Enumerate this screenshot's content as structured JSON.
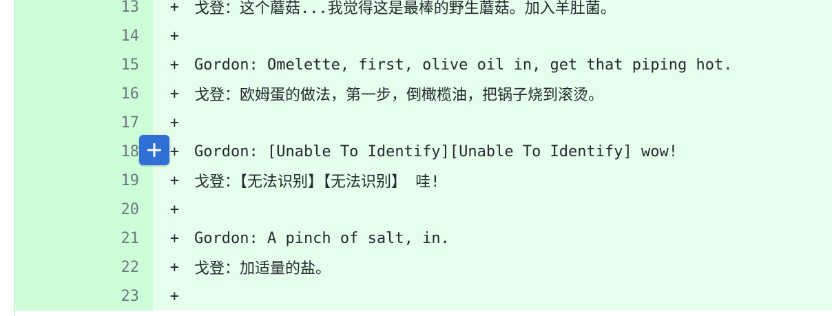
{
  "diff": {
    "lines": [
      {
        "number": "13",
        "marker": "+",
        "text": "戈登：这个蘑菇...我觉得这是最棒的野生蘑菇。加入羊肚菌。"
      },
      {
        "number": "14",
        "marker": "+",
        "text": ""
      },
      {
        "number": "15",
        "marker": "+",
        "text": "Gordon: Omelette, first, olive oil in, get that piping hot."
      },
      {
        "number": "16",
        "marker": "+",
        "text": "戈登：欧姆蛋的做法，第一步，倒橄榄油，把锅子烧到滚烫。"
      },
      {
        "number": "17",
        "marker": "+",
        "text": ""
      },
      {
        "number": "18",
        "marker": "+",
        "text": "Gordon: [Unable To Identify][Unable To Identify] wow!"
      },
      {
        "number": "19",
        "marker": "+",
        "text": "戈登：【无法识别】【无法识别】 哇!"
      },
      {
        "number": "20",
        "marker": "+",
        "text": ""
      },
      {
        "number": "21",
        "marker": "+",
        "text": "Gordon: A pinch of salt, in."
      },
      {
        "number": "22",
        "marker": "+",
        "text": "戈登：加适量的盐。"
      },
      {
        "number": "23",
        "marker": "+",
        "text": ""
      }
    ]
  },
  "add_comment_icon": "plus-icon",
  "colors": {
    "gutter_bg": "#ccffd8",
    "code_bg": "#e6ffec",
    "button_bg": "#2f6fd6"
  }
}
